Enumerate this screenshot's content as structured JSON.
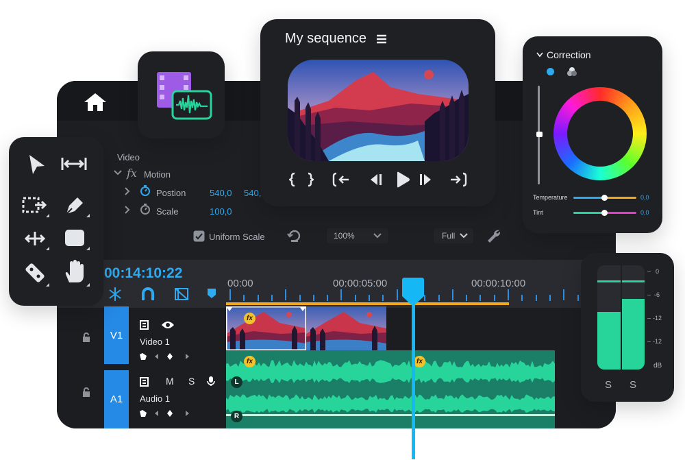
{
  "effects": {
    "section_label": "Video",
    "motion_label": "Motion",
    "position_label": "Postion",
    "position_x": "540,0",
    "position_y": "540,",
    "scale_label": "Scale",
    "scale_value": "100,0",
    "uniform_scale_label": "Uniform Scale",
    "zoom_value": "100%",
    "quality_value": "Full"
  },
  "monitor": {
    "title": "My sequence"
  },
  "timeline": {
    "timecode": "00:14:10:22",
    "ruler": [
      "00:00",
      "00:00:05:00",
      "00:00:10:00"
    ],
    "tracks": {
      "video_id": "V1",
      "video_name": "Video 1",
      "audio_id": "A1",
      "audio_name": "Audio 1",
      "mute_label": "M",
      "solo_label": "S",
      "left_channel": "L",
      "right_channel": "R",
      "fx_badge": "fx"
    }
  },
  "correction": {
    "title": "Correction",
    "temperature_label": "Temperature",
    "temperature_value": "0,0",
    "tint_label": "Tint",
    "tint_value": "0,0"
  },
  "meter": {
    "scale": [
      "0",
      "-6",
      "-12",
      "-12",
      "dB"
    ],
    "solo_left": "S",
    "solo_right": "S",
    "level_left": 0.55,
    "level_right": 0.68
  },
  "colors": {
    "accent": "#2eaaf0",
    "track_blue": "#2589e6",
    "audio_green": "#27d49a",
    "playhead": "#15b8f5",
    "work_area": "#f0a81c"
  }
}
